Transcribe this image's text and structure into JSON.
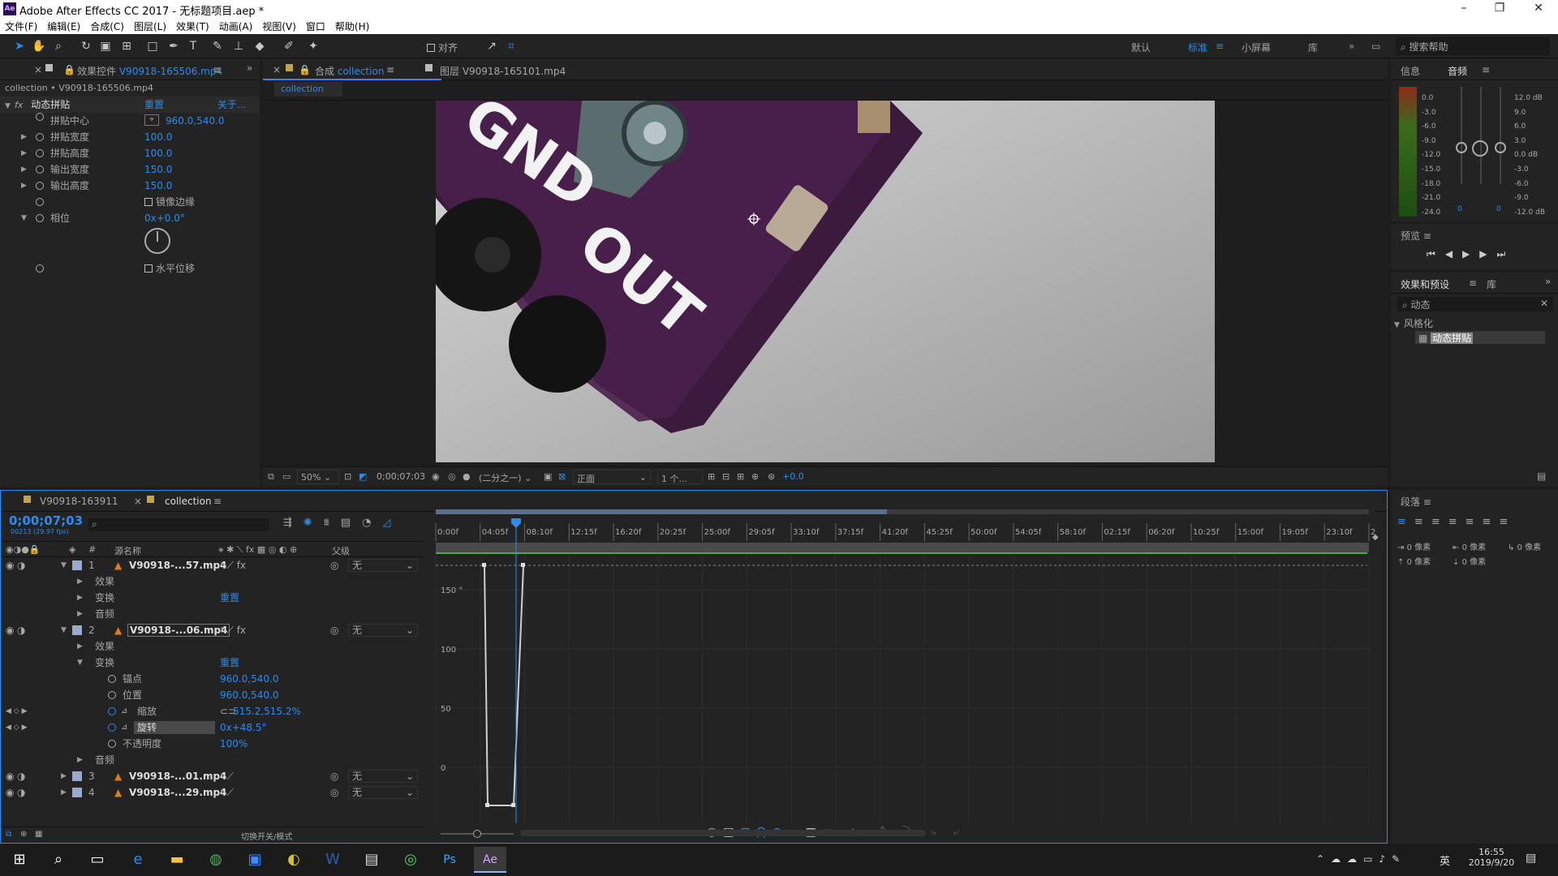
{
  "title": "Adobe After Effects CC 2017 - 无标题项目.aep *",
  "menu": [
    "文件(F)",
    "编辑(E)",
    "合成(C)",
    "图层(L)",
    "效果(T)",
    "动画(A)",
    "视图(V)",
    "窗口",
    "帮助(H)"
  ],
  "toolbar": {
    "align_label": "对齐",
    "workspaces": [
      "默认",
      "标准",
      "小屏幕",
      "库"
    ],
    "active_ws": "标准",
    "search_help": "搜索帮助"
  },
  "effect_panel": {
    "tab": "效果控件",
    "tab_file": "V90918-165506.mp4",
    "breadcrumb": "collection • V90918-165506.mp4",
    "effect_name": "动态拼贴",
    "reset": "重置",
    "about": "关于...",
    "props": [
      {
        "label": "拼贴中心",
        "value": "960.0,540.0"
      },
      {
        "label": "拼贴宽度",
        "value": "100.0"
      },
      {
        "label": "拼贴高度",
        "value": "100.0"
      },
      {
        "label": "输出宽度",
        "value": "150.0"
      },
      {
        "label": "输出高度",
        "value": "150.0"
      },
      {
        "label": "",
        "value": "镜像边缘"
      },
      {
        "label": "相位",
        "value": "0x+0.0°"
      },
      {
        "label": "",
        "value": "水平位移"
      }
    ]
  },
  "comp_panel": {
    "tab_comp_prefix": "合成",
    "tab_comp": "collection",
    "tab_layer": "图层 V90918-165101.mp4",
    "sub_tab": "collection",
    "footer": {
      "zoom": "50%",
      "time": "0;00;07;03",
      "res": "(二分之一)",
      "view": "正面",
      "views": "1 个...",
      "exposure": "+0.0"
    }
  },
  "image_text": {
    "line1": "GND",
    "line2": "OUT"
  },
  "info_panel": {
    "tab_info": "信息",
    "tab_audio": "音频",
    "db_left": [
      "0.0",
      "-3.0",
      "-6.0",
      "-9.0",
      "-12.0",
      "-15.0",
      "-18.0",
      "-21.0",
      "-24.0"
    ],
    "db_right": [
      "12.0 dB",
      "9.0",
      "6.0",
      "3.0",
      "0.0 dB",
      "-3.0",
      "-6.0",
      "-9.0",
      "-12.0 dB"
    ],
    "slider_l": "0",
    "slider_r": "0"
  },
  "preview_panel": {
    "title": "预览"
  },
  "effects_presets": {
    "tab": "效果和预设",
    "tab_lib": "库",
    "search": "动态",
    "category": "风格化",
    "item": "动态拼贴"
  },
  "paragraph": {
    "title": "段落",
    "px1": "0 像素",
    "px2": "0 像素",
    "px3": "0 像素",
    "px4": "0 像素",
    "px5": "0 像素"
  },
  "timeline": {
    "tab1": "V90918-163911",
    "tab2": "collection",
    "timecode": "0;00;07;03",
    "fps": "00213 (29.97 fps)",
    "col_src": "源名称",
    "col_parent": "父级",
    "ruler": [
      "0:00f",
      "04:05f",
      "08:10f",
      "12:15f",
      "16:20f",
      "20:25f",
      "25:00f",
      "29:05f",
      "33:10f",
      "37:15f",
      "41:20f",
      "45:25f",
      "50:00f",
      "54:05f",
      "58:10f",
      "02:15f",
      "06:20f",
      "10:25f",
      "15:00f",
      "19:05f",
      "23:10f",
      "2"
    ],
    "graph_labels": [
      "150 °",
      "100",
      "50",
      "0"
    ],
    "layers": [
      {
        "num": "1",
        "name": "V90918-...57.mp4",
        "parent": "无"
      },
      {
        "sub": "效果"
      },
      {
        "sub": "变换",
        "val": "重置"
      },
      {
        "sub": "音频"
      },
      {
        "num": "2",
        "name": "V90918-...06.mp4",
        "parent": "无"
      },
      {
        "sub": "效果"
      },
      {
        "sub": "变换",
        "val": "重置"
      },
      {
        "prop": "锚点",
        "val": "960.0,540.0"
      },
      {
        "prop": "位置",
        "val": "960.0,540.0"
      },
      {
        "prop": "缩放",
        "val": "515.2,515.2%"
      },
      {
        "prop": "旋转",
        "val": "0x+48.5°"
      },
      {
        "prop": "不透明度",
        "val": "100%"
      },
      {
        "sub": "音频"
      },
      {
        "num": "3",
        "name": "V90918-...01.mp4",
        "parent": "无"
      },
      {
        "num": "4",
        "name": "V90918-...29.mp4",
        "parent": "无"
      }
    ],
    "bottom_label": "切换开关/模式"
  },
  "taskbar": {
    "time": "16:55",
    "date": "2019/9/20",
    "ime": "英"
  },
  "colors": {
    "accent": "#2d8ceb",
    "bg": "#232323"
  }
}
